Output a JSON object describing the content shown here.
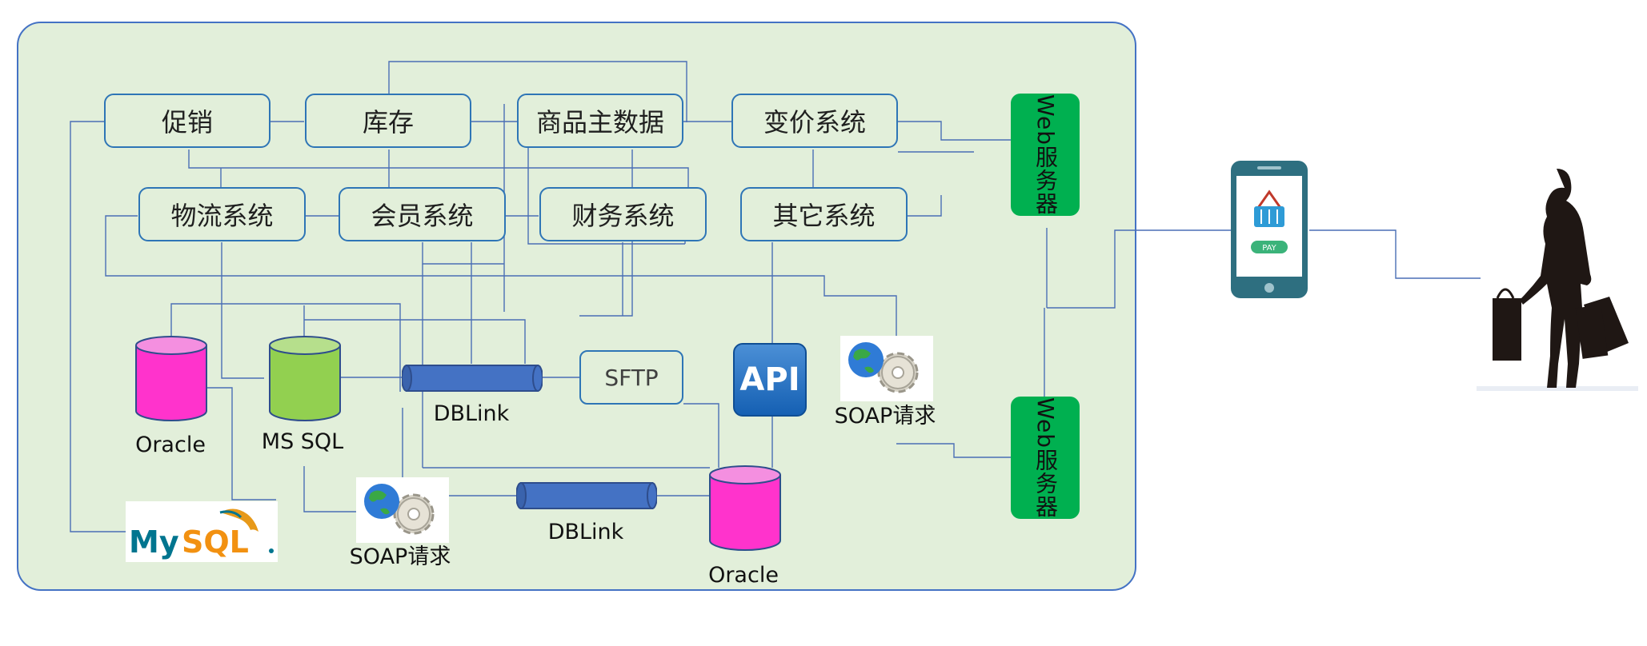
{
  "systems_row1": [
    "促销",
    "库存",
    "商品主数据",
    "变价系统"
  ],
  "systems_row2": [
    "物流系统",
    "会员系统",
    "财务系统",
    "其它系统"
  ],
  "web_servers": [
    "Web服务器",
    "Web服务器"
  ],
  "databases": {
    "oracle_left": "Oracle",
    "mssql": "MS SQL",
    "oracle_bottom": "Oracle",
    "mysql": "MySQL"
  },
  "dblink_top": "DBLink",
  "dblink_bottom": "DBLink",
  "sftp": "SFTP",
  "api": "API",
  "soap_right": "SOAP请求",
  "soap_bottom": "SOAP请求",
  "phone_pay": "PAY",
  "colors": {
    "panel_bg": "#e2efda",
    "panel_border": "#4472c4",
    "web_server": "#00b050",
    "oracle": "#ff33cc",
    "mssql": "#92d050",
    "dblink": "#4472c4",
    "line": "#4a6fb5"
  }
}
